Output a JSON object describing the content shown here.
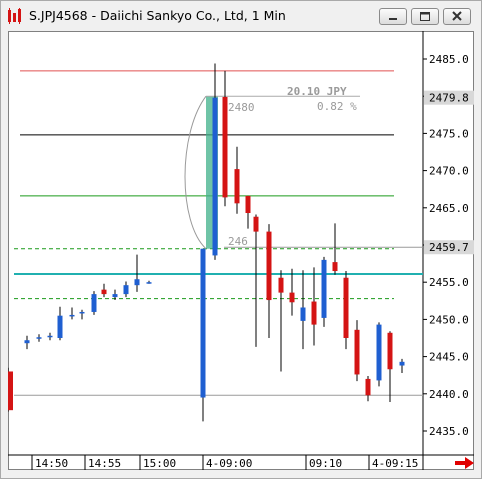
{
  "window": {
    "title": "S.JPJ4568 - Daiichi Sankyo Co., Ltd, 1 Min",
    "buttons": [
      "minimize",
      "restore",
      "close"
    ]
  },
  "chart": {
    "y_ticks": [
      "2485.0",
      "2480.0",
      "2475.0",
      "2470.0",
      "2465.0",
      "2460.0",
      "2455.0",
      "2450.0",
      "2445.0",
      "2440.0",
      "2435.0"
    ],
    "x_ticks": [
      "14:50",
      "14:55",
      "15:00",
      "4-09:00",
      "09:10",
      "4-09:15"
    ],
    "current_price": "2479.8",
    "second_price_label": "2459.7",
    "measure_label_jpy": "20.10 JPY",
    "measure_label_pct": "0.82 %",
    "measure_start": "2480",
    "measure_end": "246",
    "colors": {
      "up": "#1f5fd1",
      "down": "#d41414",
      "red_line": "#e05050",
      "green_line": "#1a9a1a",
      "teal_line": "#20b0b0",
      "measure_fill": "#3fb08a"
    }
  },
  "chart_data": {
    "type": "candlestick",
    "ylim": [
      2432.0,
      2489.0
    ],
    "hlines": [
      2483.4,
      2474.8,
      2466.6,
      2459.5,
      2456.1,
      2452.8,
      2439.8
    ],
    "candles": [
      {
        "o": 2446.8,
        "h": 2447.8,
        "l": 2446.0,
        "c": 2447.2
      },
      {
        "o": 2447.4,
        "h": 2448.0,
        "l": 2447.0,
        "c": 2447.6
      },
      {
        "o": 2447.6,
        "h": 2448.2,
        "l": 2447.2,
        "c": 2447.8
      },
      {
        "o": 2447.5,
        "h": 2451.7,
        "l": 2447.2,
        "c": 2450.5
      },
      {
        "o": 2450.5,
        "h": 2451.6,
        "l": 2450.0,
        "c": 2450.6
      },
      {
        "o": 2450.8,
        "h": 2451.3,
        "l": 2450.0,
        "c": 2451.0
      },
      {
        "o": 2451.0,
        "h": 2453.8,
        "l": 2450.6,
        "c": 2453.4
      },
      {
        "o": 2454.0,
        "h": 2454.8,
        "l": 2453.0,
        "c": 2453.4
      },
      {
        "o": 2453.0,
        "h": 2454.0,
        "l": 2452.6,
        "c": 2453.4
      },
      {
        "o": 2453.4,
        "h": 2455.1,
        "l": 2453.0,
        "c": 2454.6
      },
      {
        "o": 2454.6,
        "h": 2458.7,
        "l": 2453.7,
        "c": 2455.4
      },
      {
        "o": 2455.0,
        "h": 2455.2,
        "l": 2454.8,
        "c": 2455.0
      },
      {
        "o": 2439.5,
        "h": 2459.5,
        "l": 2436.3,
        "c": 2459.5
      },
      {
        "o": 2458.6,
        "h": 2484.4,
        "l": 2458.0,
        "c": 2479.8
      },
      {
        "o": 2479.9,
        "h": 2483.4,
        "l": 2465.2,
        "c": 2466.4
      },
      {
        "o": 2470.2,
        "h": 2473.2,
        "l": 2464.2,
        "c": 2465.6
      },
      {
        "o": 2466.6,
        "h": 2466.6,
        "l": 2462.2,
        "c": 2464.3
      },
      {
        "o": 2463.8,
        "h": 2464.1,
        "l": 2446.3,
        "c": 2461.8
      },
      {
        "o": 2461.8,
        "h": 2462.8,
        "l": 2447.5,
        "c": 2452.6
      },
      {
        "o": 2455.6,
        "h": 2456.6,
        "l": 2443.0,
        "c": 2453.6
      },
      {
        "o": 2453.6,
        "h": 2456.8,
        "l": 2450.5,
        "c": 2452.3
      },
      {
        "o": 2449.8,
        "h": 2456.6,
        "l": 2446.0,
        "c": 2451.6
      },
      {
        "o": 2452.4,
        "h": 2457.0,
        "l": 2446.5,
        "c": 2449.3
      },
      {
        "o": 2450.2,
        "h": 2458.4,
        "l": 2449.0,
        "c": 2458.0
      },
      {
        "o": 2457.7,
        "h": 2462.9,
        "l": 2456.0,
        "c": 2456.5
      },
      {
        "o": 2455.6,
        "h": 2456.5,
        "l": 2446.0,
        "c": 2447.5
      },
      {
        "o": 2448.6,
        "h": 2449.9,
        "l": 2441.7,
        "c": 2442.6
      },
      {
        "o": 2442.0,
        "h": 2442.4,
        "l": 2439.0,
        "c": 2439.8
      },
      {
        "o": 2441.8,
        "h": 2449.6,
        "l": 2441.0,
        "c": 2449.3
      },
      {
        "o": 2448.2,
        "h": 2448.4,
        "l": 2438.9,
        "c": 2443.3
      },
      {
        "o": 2443.8,
        "h": 2444.7,
        "l": 2442.8,
        "c": 2444.3
      },
      {
        "o": 2443.0,
        "h": 2443.5,
        "l": 2437.6,
        "c": 2437.8
      }
    ],
    "candle_x": [
      19,
      31,
      42,
      52,
      64,
      74,
      86,
      96,
      107,
      118,
      129,
      141,
      195,
      207,
      217,
      229,
      240,
      248,
      261,
      273,
      284,
      295,
      306,
      316,
      327,
      338,
      349,
      360,
      371,
      382,
      394
    ]
  }
}
